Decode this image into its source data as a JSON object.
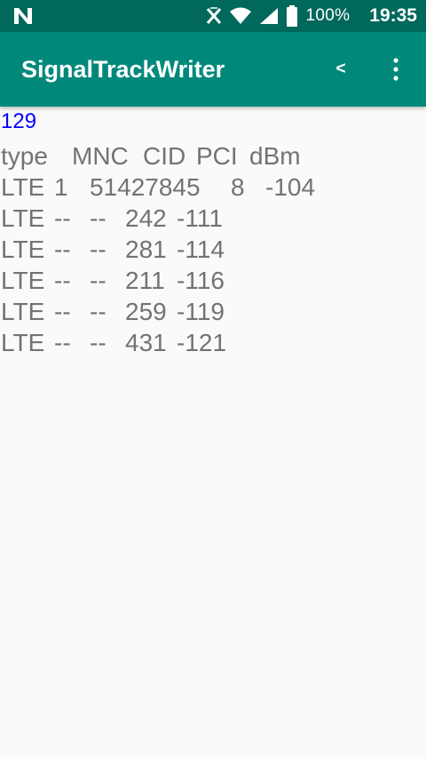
{
  "status_bar": {
    "battery_pct": "100%",
    "clock": "19:35",
    "icons": [
      "n-icon",
      "x-icon",
      "wifi-icon",
      "cell-signal-icon",
      "battery-icon"
    ]
  },
  "app_bar": {
    "title": "SignalTrackWriter",
    "back_label": "<",
    "menu_icon": "overflow-menu-icon"
  },
  "count": "129",
  "table": {
    "headers": [
      "type",
      "MNC",
      "CID",
      "PCI",
      "dBm"
    ],
    "first_row": {
      "type": "LTE",
      "mnc": "1",
      "cid": "51427845",
      "pci": "8",
      "dbm": "-104"
    },
    "rows": [
      {
        "type": "LTE",
        "mnc": "--",
        "cid": "--",
        "pci": "242",
        "dbm": "-111"
      },
      {
        "type": "LTE",
        "mnc": "--",
        "cid": "--",
        "pci": "281",
        "dbm": "-114"
      },
      {
        "type": "LTE",
        "mnc": "--",
        "cid": "--",
        "pci": "211",
        "dbm": "-116"
      },
      {
        "type": "LTE",
        "mnc": "--",
        "cid": "--",
        "pci": "259",
        "dbm": "-119"
      },
      {
        "type": "LTE",
        "mnc": "--",
        "cid": "--",
        "pci": "431",
        "dbm": "-121"
      }
    ]
  },
  "colors": {
    "status_bar": "#00695c",
    "app_bar": "#00897b",
    "count_text": "#0000ff",
    "table_text": "#737373",
    "background": "#fafafa"
  }
}
